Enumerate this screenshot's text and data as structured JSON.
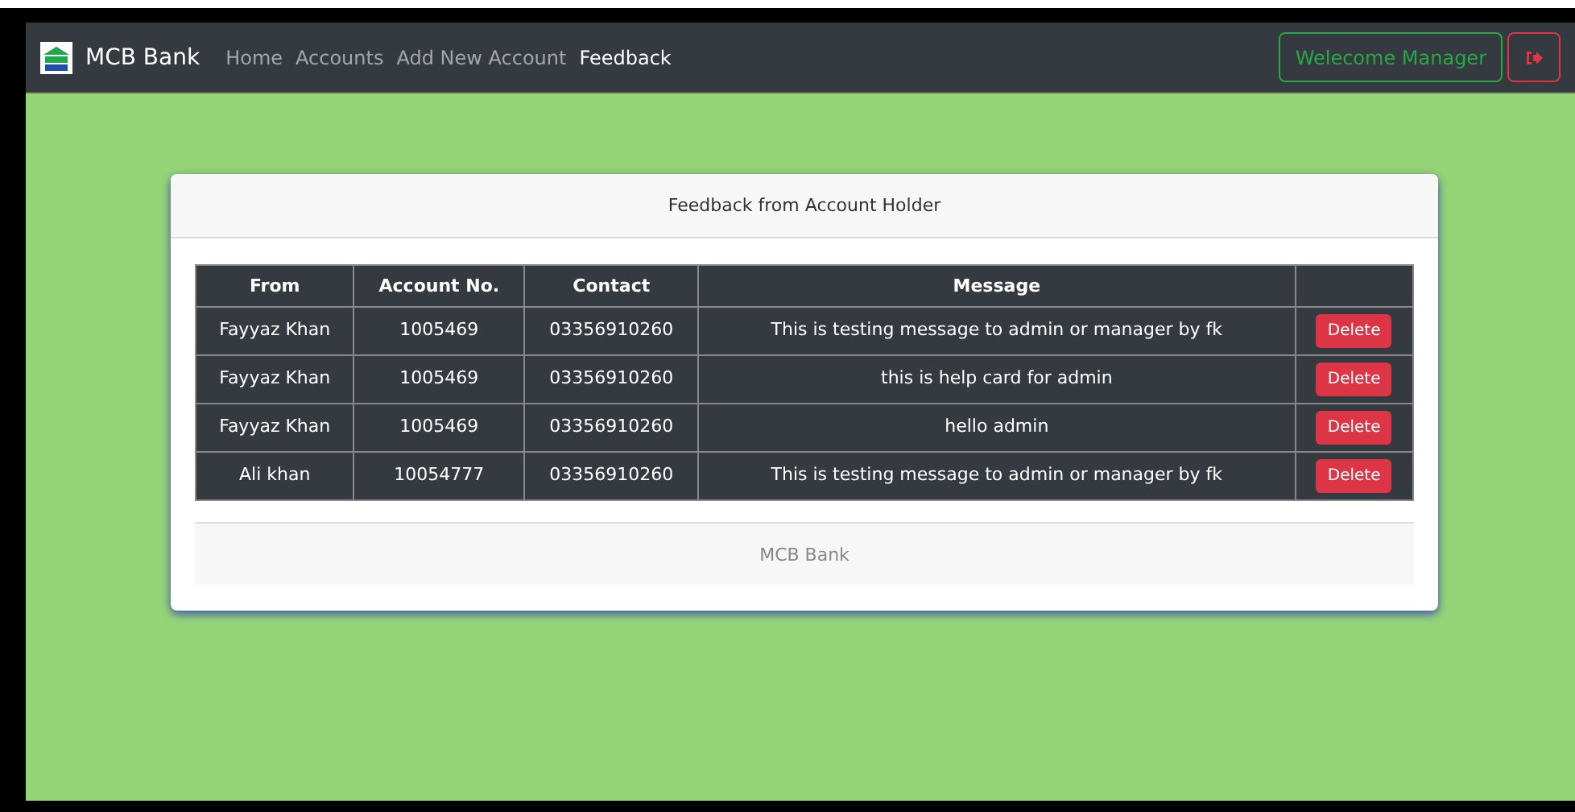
{
  "navbar": {
    "brand": "MCB Bank",
    "links": [
      {
        "label": "Home",
        "selected": false
      },
      {
        "label": "Accounts",
        "selected": false
      },
      {
        "label": "Add New Account",
        "selected": false
      },
      {
        "label": "Feedback",
        "selected": true
      }
    ],
    "welcome": "Welecome Manager"
  },
  "card": {
    "title": "Feedback from Account Holder",
    "footer": "MCB Bank",
    "table": {
      "columns": [
        "From",
        "Account No.",
        "Contact",
        "Message"
      ],
      "rows": [
        {
          "from": "Fayyaz Khan",
          "account": "1005469",
          "contact": "03356910260",
          "message": "This is testing message to admin or manager by fk",
          "action": "Delete"
        },
        {
          "from": "Fayyaz Khan",
          "account": "1005469",
          "contact": "03356910260",
          "message": "this is help card for admin",
          "action": "Delete"
        },
        {
          "from": "Fayyaz Khan",
          "account": "1005469",
          "contact": "03356910260",
          "message": "hello admin",
          "action": "Delete"
        },
        {
          "from": "Ali khan",
          "account": "10054777",
          "contact": "03356910260",
          "message": "This is testing message to admin or manager by fk",
          "action": "Delete"
        }
      ]
    }
  }
}
